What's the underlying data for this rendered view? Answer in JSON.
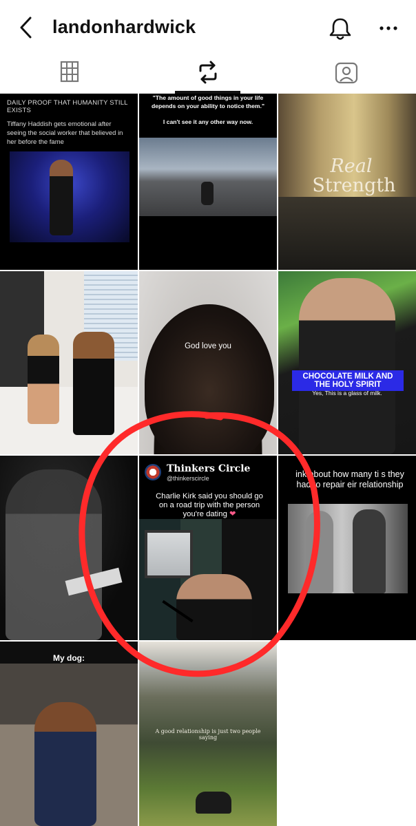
{
  "header": {
    "username": "landonhardwick",
    "back_icon": "chevron-left-icon",
    "notifications_icon": "bell-icon",
    "more_icon": "ellipsis-horizontal-icon"
  },
  "tabs": [
    {
      "icon": "grid-icon",
      "active": false
    },
    {
      "icon": "repost-icon",
      "active": true
    },
    {
      "icon": "tagged-person-icon",
      "active": false
    }
  ],
  "posts": [
    {
      "caption_top": "DAILY PROOF THAT HUMANITY STILL EXISTS",
      "caption": "Tiffany Haddish gets emotional after seeing the social worker that believed in her before the fame"
    },
    {
      "quote": "\"The amount of good things in your life depends on your ability to notice them.\"",
      "subquote": "I can't see it any other way now."
    },
    {
      "title_line1": "Real",
      "title_line2": "Strength"
    },
    {},
    {
      "caption": "God love you"
    },
    {
      "banner": "CHOCOLATE MILK AND THE HOLY SPIRIT",
      "subcaption": "Yes, This is a glass of milk."
    },
    {},
    {
      "brand": "Thinkers Circle",
      "handle": "@thinkerscircle",
      "caption": "Charlie Kirk said you should go on a road trip with the person you're dating",
      "emoji": "❤"
    },
    {
      "caption": "ink about how many ti s they had to repair eir relationship"
    },
    {
      "label": "My dog:"
    },
    {
      "caption": "A good relationship is just two people saying"
    }
  ],
  "annotation": {
    "shape": "circle",
    "color": "#ff2a2a"
  },
  "colors": {
    "text": "#111111",
    "accent_red": "#ff2a2a",
    "banner_blue": "#2b2ae6"
  }
}
